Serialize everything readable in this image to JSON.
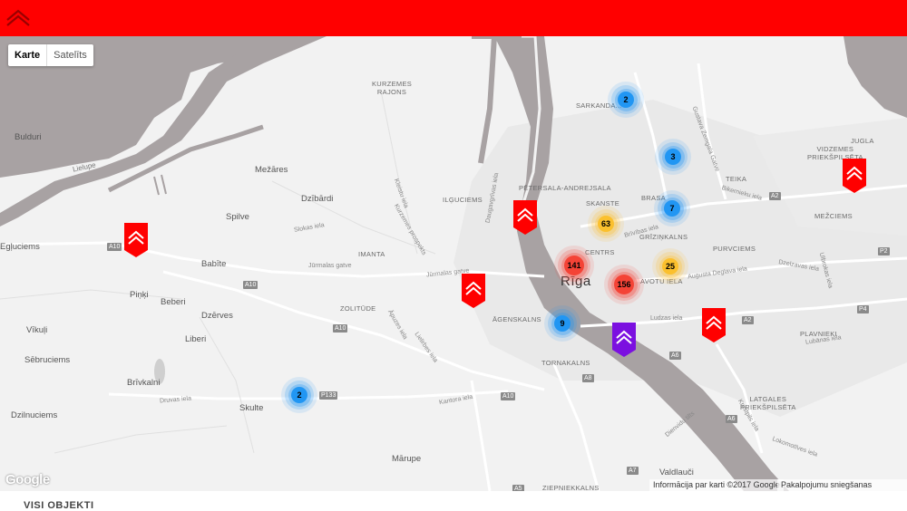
{
  "header": {
    "logo_icon": "car-brand-logo-icon",
    "bg_color": "#ff0000"
  },
  "map_type": {
    "map_label": "Karte",
    "satellite_label": "Satelīts"
  },
  "places": [
    {
      "id": "bulduri",
      "text": "Bulduri"
    },
    {
      "id": "lielupe",
      "text": "Lielupe"
    },
    {
      "id": "mezares",
      "text": "Mežāres"
    },
    {
      "id": "dzibardi",
      "text": "Dzībārdi"
    },
    {
      "id": "spilve",
      "text": "Spilve"
    },
    {
      "id": "egluciems",
      "text": "Egļuciems"
    },
    {
      "id": "babite",
      "text": "Babīte"
    },
    {
      "id": "pinki",
      "text": "Piņķi"
    },
    {
      "id": "beberi",
      "text": "Beberi"
    },
    {
      "id": "dzerves",
      "text": "Dzērves"
    },
    {
      "id": "vikuli",
      "text": "Vīkuļi"
    },
    {
      "id": "liberi",
      "text": "Liberi"
    },
    {
      "id": "sebruciems",
      "text": "Sēbruciems"
    },
    {
      "id": "brivkalni",
      "text": "Brīvkalni"
    },
    {
      "id": "skulte",
      "text": "Skulte"
    },
    {
      "id": "dzilnuciems",
      "text": "Dzilnuciems"
    },
    {
      "id": "marupe",
      "text": "Mārupe"
    },
    {
      "id": "valdlauci",
      "text": "Valdlauči"
    },
    {
      "id": "plavnieki",
      "text": "PLAVNIEKI"
    },
    {
      "id": "purvciems",
      "text": "PURVCIEMS"
    },
    {
      "id": "mezciems",
      "text": "MEŽCIEMS"
    },
    {
      "id": "jugla",
      "text": "JUGLA"
    },
    {
      "id": "teika",
      "text": "TEIKA"
    },
    {
      "id": "brasa",
      "text": "BRASA"
    },
    {
      "id": "sarkandaugava",
      "text": "SARKANDA..."
    },
    {
      "id": "grizinkalns",
      "text": "GRĪZIŅKALNS"
    },
    {
      "id": "centrs",
      "text": "CENTRS"
    },
    {
      "id": "avotu",
      "text": "AVOTU IELA"
    },
    {
      "id": "agenskalns",
      "text": "ĀGENSKALNS"
    },
    {
      "id": "tornakalns",
      "text": "TORNAKALNS"
    },
    {
      "id": "imanta",
      "text": "IMANTA"
    },
    {
      "id": "zolitude",
      "text": "ZOLITŪDE"
    },
    {
      "id": "ilguciems",
      "text": "ILĢUCIEMS"
    },
    {
      "id": "skanste",
      "text": "SKANSTE"
    }
  ],
  "districts": [
    {
      "id": "kurzemes",
      "text": "KURZEMES\nRAJONS"
    },
    {
      "id": "petersala",
      "text": "PĒTERSALA-ANDREJSALA"
    },
    {
      "id": "vidzemes",
      "text": "VIDZEMES\nPRIEKŠPILSĒTA"
    },
    {
      "id": "latgales",
      "text": "LATGALES\nPRIEKŠPILSĒTA"
    },
    {
      "id": "ziepniekkalns",
      "text": "ZIEPNIEKKALNS"
    }
  ],
  "roads": [
    {
      "id": "jurmalas",
      "text": "Jūrmalas gatve"
    },
    {
      "id": "jurmalas2",
      "text": "Jūrmalas gatve"
    },
    {
      "id": "slokas",
      "text": "Slokas iela"
    },
    {
      "id": "kurzemes_pr",
      "text": "Kurzemes prospekts"
    },
    {
      "id": "kleistu",
      "text": "Kleistu iela"
    },
    {
      "id": "daugavgrivas",
      "text": "Daugavgrīvas iela"
    },
    {
      "id": "lubanas",
      "text": "Lubānas iela"
    },
    {
      "id": "ludzas",
      "text": "Ludzas iela"
    },
    {
      "id": "brivibas",
      "text": "Brīvības iela"
    },
    {
      "id": "kantora",
      "text": "Kantora iela"
    },
    {
      "id": "druvas",
      "text": "Druvas iela"
    },
    {
      "id": "biekensalas",
      "text": "Bikernieku iela"
    },
    {
      "id": "dienvidu",
      "text": "Dienvidu tilts"
    },
    {
      "id": "apuzes",
      "text": "Āpuzes iela"
    },
    {
      "id": "lielirbes",
      "text": "Lielirbes iela"
    },
    {
      "id": "gustava",
      "text": "Gustava Zemgala Gatve"
    },
    {
      "id": "augusta",
      "text": "Augusta Deglava iela"
    },
    {
      "id": "dzelzavas",
      "text": "Dzelzavas iela"
    },
    {
      "id": "ulbrokas",
      "text": "Ulbrokas iela"
    },
    {
      "id": "lokomotives",
      "text": "Lokomotīves iela"
    },
    {
      "id": "krustpils",
      "text": "Krustpils iela"
    }
  ],
  "shields": [
    {
      "id": "a10a",
      "text": "A10"
    },
    {
      "id": "a10b",
      "text": "A10"
    },
    {
      "id": "a10c",
      "text": "A10"
    },
    {
      "id": "a10d",
      "text": "A10"
    },
    {
      "id": "a2a",
      "text": "A2"
    },
    {
      "id": "a2b",
      "text": "A2"
    },
    {
      "id": "p2",
      "text": "P2"
    },
    {
      "id": "p4",
      "text": "P4"
    },
    {
      "id": "a6a",
      "text": "A6"
    },
    {
      "id": "a6b",
      "text": "A6"
    },
    {
      "id": "a7",
      "text": "A7"
    },
    {
      "id": "a8",
      "text": "A8"
    },
    {
      "id": "p133",
      "text": "P133"
    },
    {
      "id": "a5",
      "text": "A5"
    }
  ],
  "city_label": "Rīga",
  "clusters": [
    {
      "id": "c-sarkandaugava",
      "count": "2",
      "color": "blue"
    },
    {
      "id": "c-teika",
      "count": "3",
      "color": "blue"
    },
    {
      "id": "c-brasa",
      "count": "7",
      "color": "blue"
    },
    {
      "id": "c-skanste",
      "count": "63",
      "color": "yellow"
    },
    {
      "id": "c-centrs",
      "count": "141",
      "color": "red"
    },
    {
      "id": "c-avotu",
      "count": "156",
      "color": "red"
    },
    {
      "id": "c-grizinkalns",
      "count": "25",
      "color": "yellow"
    },
    {
      "id": "c-agenskalns",
      "count": "9",
      "color": "blue"
    },
    {
      "id": "c-skulte",
      "count": "2",
      "color": "blue"
    }
  ],
  "cluster_colors": {
    "blue": "#2196f3",
    "yellow": "#fbc02d",
    "red": "#f44336"
  },
  "markers": [
    {
      "id": "m-babite",
      "color": "#ff0000"
    },
    {
      "id": "m-ilguciems",
      "color": "#ff0000"
    },
    {
      "id": "m-agenskalns",
      "color": "#ff0000"
    },
    {
      "id": "m-jugla",
      "color": "#ff0000"
    },
    {
      "id": "m-plavnieki",
      "color": "#ff0000"
    },
    {
      "id": "m-maskavas",
      "color": "#7b10e0"
    }
  ],
  "attribution": {
    "google": "Google",
    "data": "Informācija par karti ©2017 Google",
    "report": "Pakalpojumu sniegšanas noteikumi"
  },
  "footer": {
    "title": "VISI OBJEKTI"
  }
}
